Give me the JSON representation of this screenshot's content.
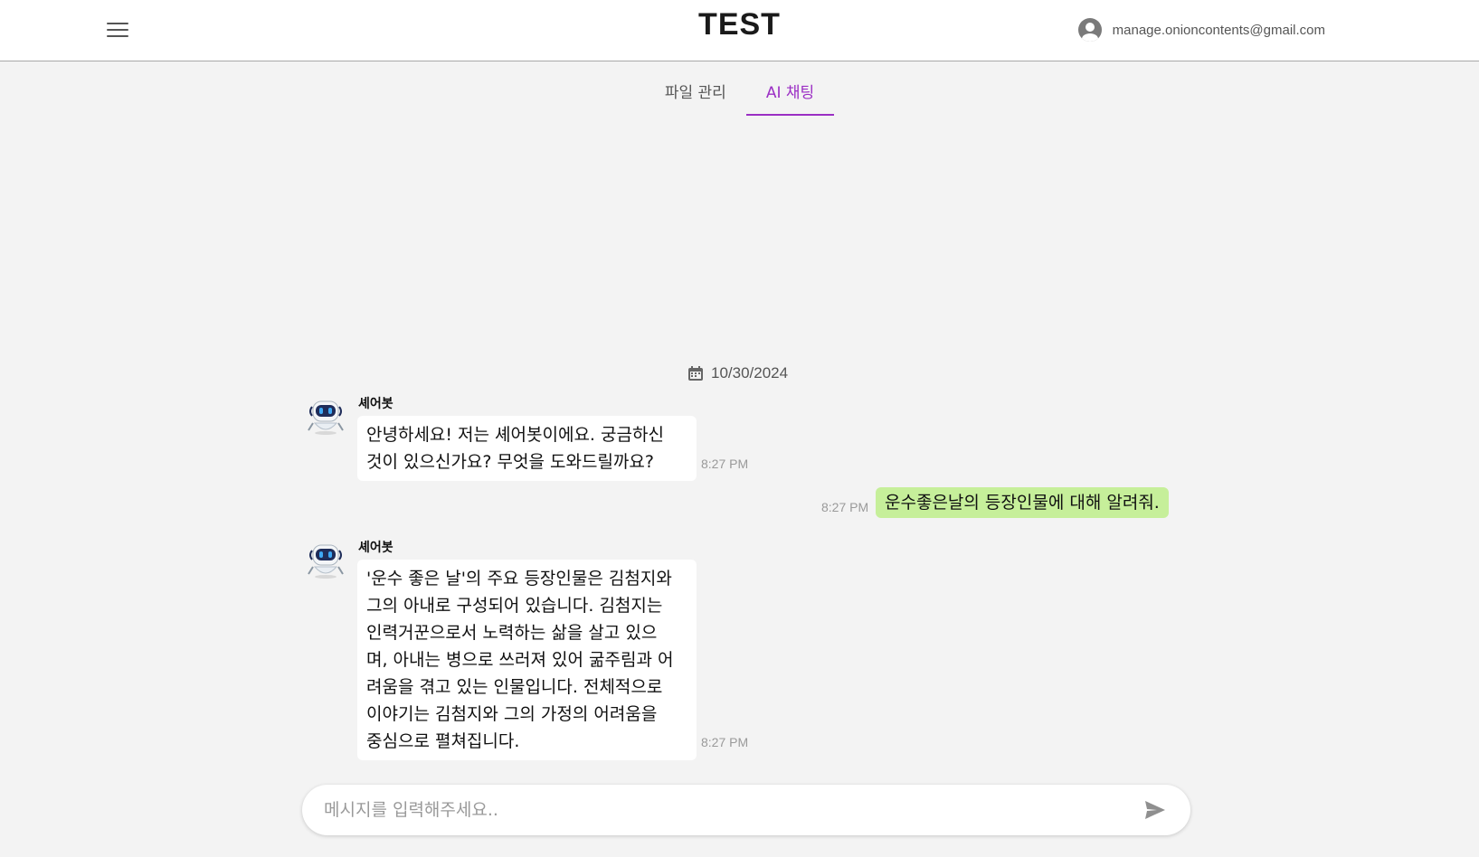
{
  "header": {
    "brand": "TEST",
    "account_email": "manage.onioncontents@gmail.com"
  },
  "tabs": [
    {
      "label": "파일 관리",
      "active": false
    },
    {
      "label": "AI 채팅",
      "active": true
    }
  ],
  "chat": {
    "date": "10/30/2024",
    "messages": [
      {
        "sender": "셰어봇",
        "role": "bot",
        "lines": [
          "안녕하세요! 저는 셰어봇이에요. 궁금하신",
          "것이 있으신가요? 무엇을 도와드릴까요?"
        ],
        "time": "8:27 PM"
      },
      {
        "role": "user",
        "text": "운수좋은날의 등장인물에 대해 알려줘.",
        "time": "8:27 PM"
      },
      {
        "sender": "셰어봇",
        "role": "bot",
        "lines": [
          "'운수 좋은 날'의 주요 등장인물은 김첨지와",
          "그의 아내로 구성되어 있습니다. 김첨지는",
          "인력거꾼으로서 노력하는 삶을 살고 있으",
          "며, 아내는 병으로 쓰러져 있어 굶주림과 어",
          "려움을 겪고 있는 인물입니다. 전체적으로",
          "이야기는 김첨지와 그의 가정의 어려움을",
          "중심으로 펼쳐집니다."
        ],
        "time": "8:27 PM"
      }
    ]
  },
  "composer": {
    "placeholder": "메시지를 입력해주세요.."
  },
  "colors": {
    "accent": "#9b2fc4",
    "user_bubble": "#c6ef9a",
    "background": "#f3f3f3"
  }
}
